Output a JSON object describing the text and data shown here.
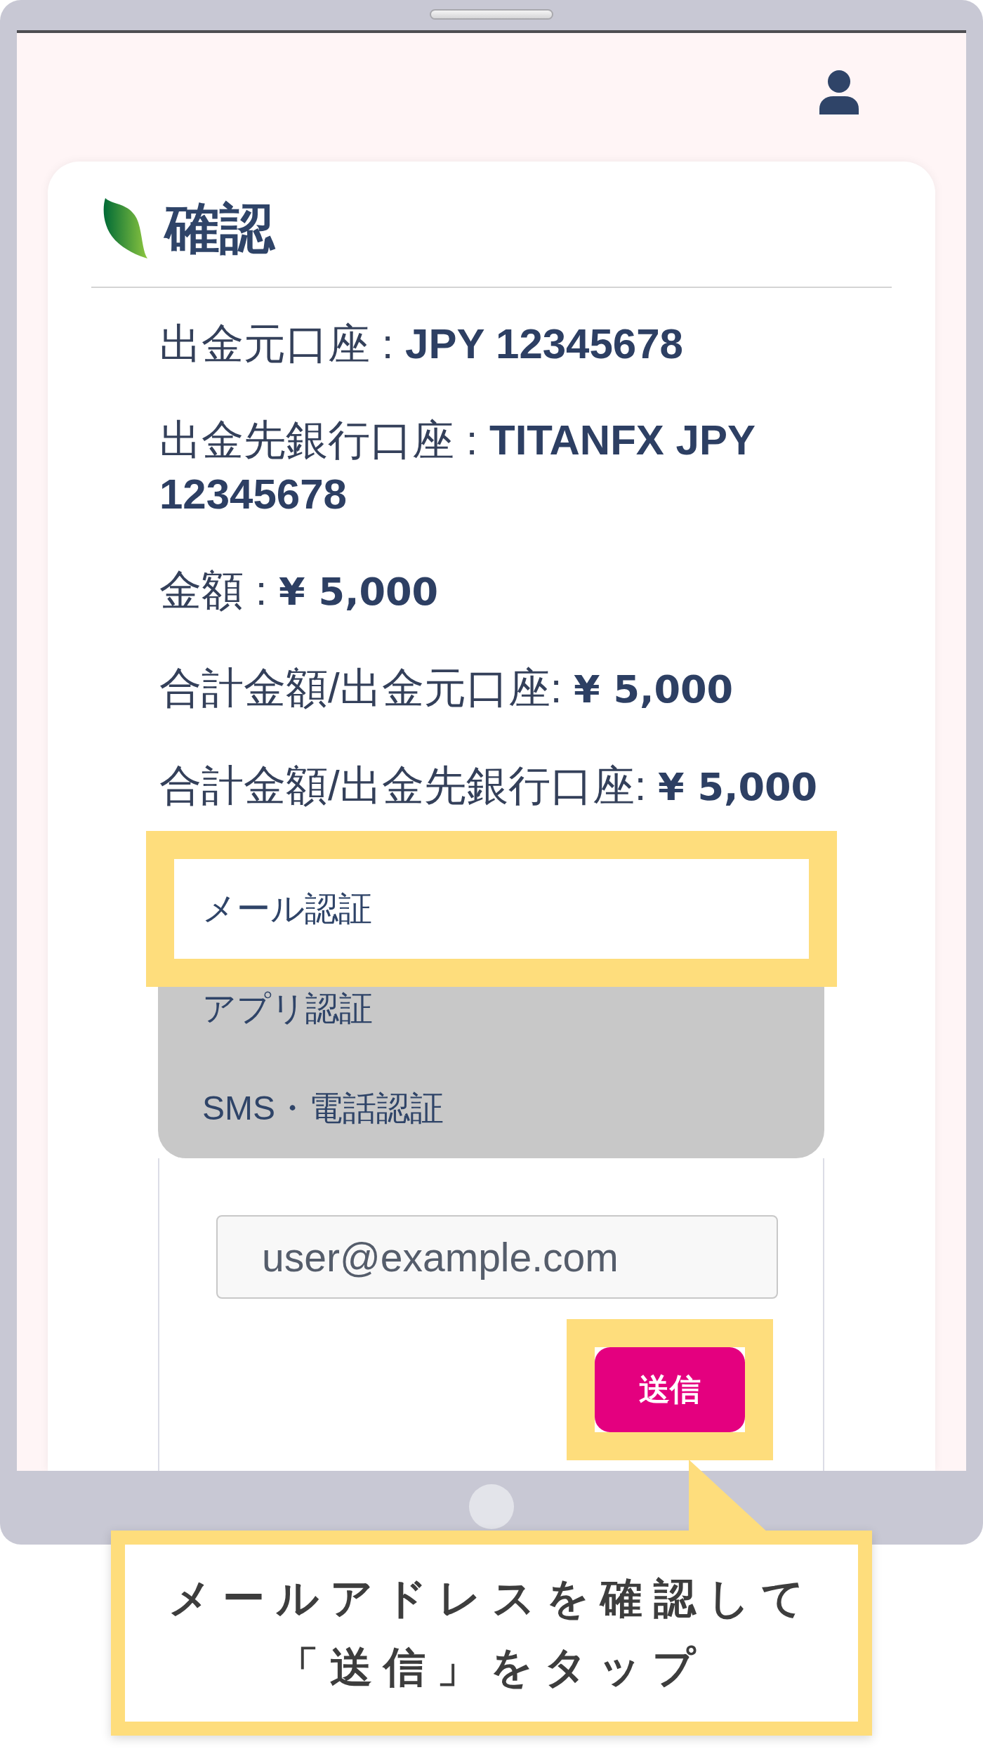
{
  "title": "確認",
  "details": [
    {
      "kind": "account",
      "label": "出金元口座 :",
      "value": "JPY 12345678"
    },
    {
      "kind": "account",
      "label": "出金先銀行口座 :",
      "value": "TITANFX JPY 12345678"
    },
    {
      "kind": "amount",
      "label": "金額 :",
      "value": "¥ 5,000"
    },
    {
      "kind": "amount",
      "label": "合計金額/出金元口座:",
      "value": "¥ 5,000"
    },
    {
      "kind": "amount",
      "label": "合計金額/出金先銀行口座:",
      "value": "¥ 5,000"
    }
  ],
  "verification_methods": [
    {
      "label": "メール認証",
      "selected": true,
      "highlighted": true
    },
    {
      "label": "アプリ認証",
      "selected": false,
      "highlighted": false
    },
    {
      "label": "SMS・電話認証",
      "selected": false,
      "highlighted": false
    }
  ],
  "email_field": {
    "value": "user@example.com"
  },
  "send_button": {
    "label": "送信",
    "highlighted": true
  },
  "callout": {
    "lines": [
      "メールアドレスを確認して",
      "「送信」をタップ"
    ]
  }
}
